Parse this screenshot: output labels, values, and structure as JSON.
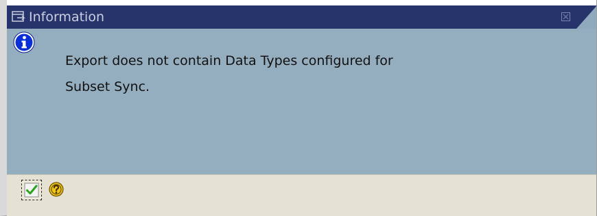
{
  "window": {
    "title": "Information"
  },
  "message": {
    "line1": "Export does not contain Data Types configured for",
    "line2": "Subset Sync."
  },
  "icons": {
    "title": "popup-window-icon",
    "close": "close-icon",
    "info": "info-icon",
    "ok": "checkmark-icon",
    "help": "help-icon"
  },
  "colors": {
    "titlebar": "#27336b",
    "content": "#95aebf",
    "toolbar": "#e6e2d3",
    "info_icon": "#0b2fd6",
    "ok_check": "#2aa31e",
    "help_yellow": "#f0c419"
  }
}
